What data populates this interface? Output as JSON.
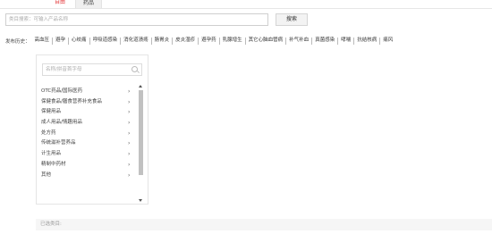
{
  "tabs": [
    {
      "label": "自由",
      "active": true
    },
    {
      "label": "药品",
      "active": false
    }
  ],
  "search": {
    "placeholder": "类目搜索：可输入产品名称",
    "button": "搜索"
  },
  "history": {
    "label": "发布历史：",
    "items": [
      "高血压",
      "避孕",
      "心绞痛",
      "呼吸道感染",
      "消化道溃疡",
      "肠胃炎",
      "皮炎湿疹",
      "避孕药",
      "乳腺增生",
      "其它心脑血管病",
      "补气补血",
      "真菌感染",
      "哮喘",
      "抗结核病",
      "痛风"
    ]
  },
  "picker": {
    "search_placeholder": "名称/拼音首字母",
    "items": [
      "OTC药品/国际医药",
      "保健食品/膳食营养补充食品",
      "保健用品",
      "成人用品/情趣用品",
      "处方药",
      "传统滋补营养品",
      "计生用品",
      "精制中药材",
      "其他"
    ]
  },
  "selected": {
    "label": "已选类目:"
  },
  "colors": {
    "accent": "#e4393c",
    "scroll_thumb": "#c1c1c1",
    "selected_bg": "#f6f6f6"
  }
}
